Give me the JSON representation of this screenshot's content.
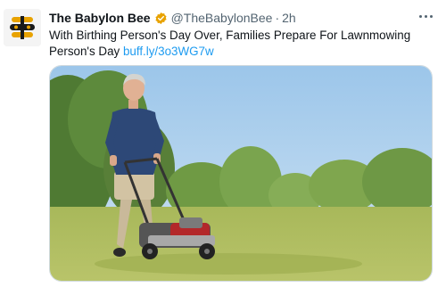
{
  "tweet": {
    "account_name": "The Babylon Bee",
    "handle": "@TheBabylonBee",
    "separator": "·",
    "time": "2h",
    "text": "With Birthing Person's Day Over, Families Prepare For Lawnmowing Person's Day",
    "link": "buff.ly/3o3WG7w",
    "more_icon": "more-horizontal-icon",
    "verified_icon": "verified-badge-icon",
    "badge_color": "#e8a200",
    "link_color": "#1d9bf0"
  }
}
